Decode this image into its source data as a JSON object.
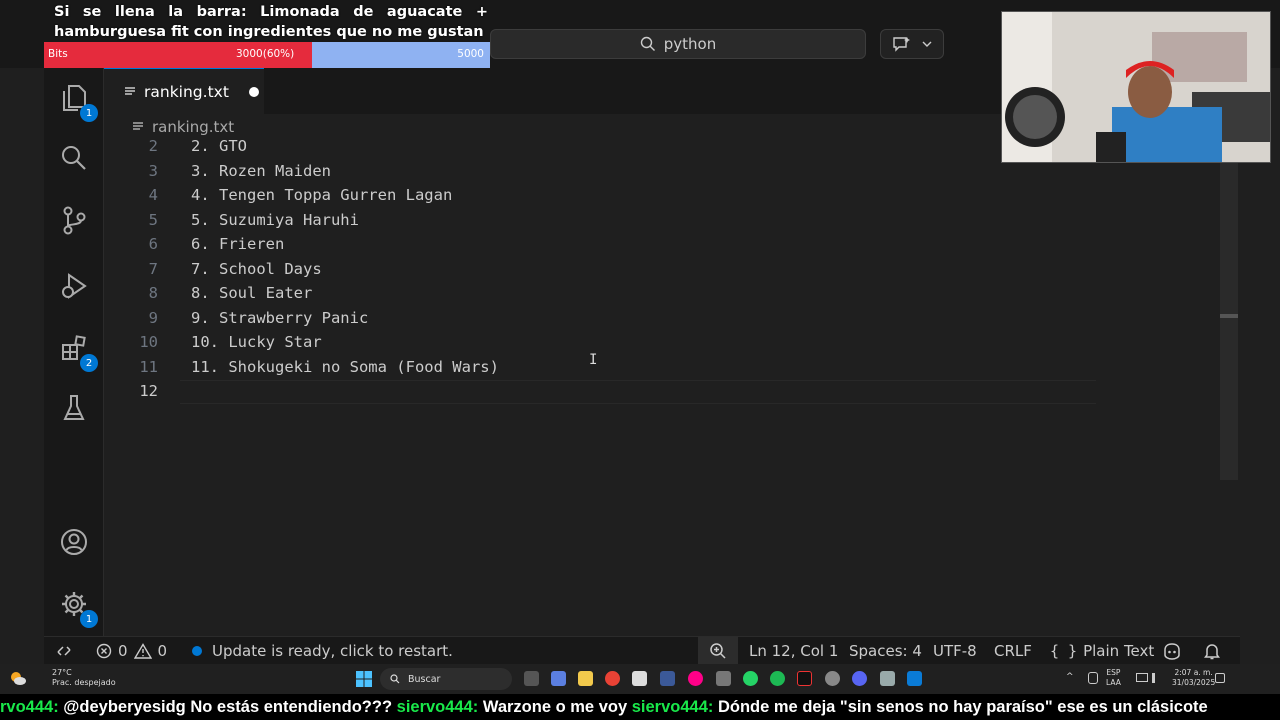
{
  "goal": {
    "text": "Si se llena la barra: Limonada de aguacate + hamburguesa fit con ingredientes que no me gustan",
    "bits_label": "Bits",
    "progress_label": "3000(60%)",
    "target_label": "5000",
    "progress_fraction": 0.6,
    "fill_color": "#e52b3d",
    "rest_color": "#8fb2f2"
  },
  "titlebar": {
    "search_text": "python"
  },
  "activity_bar": {
    "explorer_badge": "1",
    "extensions_badge": "2",
    "settings_badge": "1"
  },
  "tab": {
    "label": "ranking.txt"
  },
  "breadcrumb": {
    "file": "ranking.txt"
  },
  "editor": {
    "lines": [
      {
        "num": "2",
        "text": "2. GTO"
      },
      {
        "num": "3",
        "text": "3. Rozen Maiden"
      },
      {
        "num": "4",
        "text": "4. Tengen Toppa Gurren Lagan"
      },
      {
        "num": "5",
        "text": "5. Suzumiya Haruhi"
      },
      {
        "num": "6",
        "text": "6. Frieren"
      },
      {
        "num": "7",
        "text": "7. School Days"
      },
      {
        "num": "8",
        "text": "8. Soul Eater"
      },
      {
        "num": "9",
        "text": "9. Strawberry Panic"
      },
      {
        "num": "10",
        "text": "10. Lucky Star"
      },
      {
        "num": "11",
        "text": "11. Shokugeki no Soma (Food Wars)"
      },
      {
        "num": "12",
        "text": ""
      }
    ]
  },
  "statusbar": {
    "errors": "0",
    "warnings": "0",
    "update_message": "Update is ready, click to restart.",
    "cursor_position": "Ln 12, Col 1",
    "spaces": "Spaces: 4",
    "encoding": "UTF-8",
    "eol": "CRLF",
    "language": "Plain Text"
  },
  "taskbar": {
    "temperature": "27°C",
    "weather": "Prac. despejado",
    "search_placeholder": "Buscar",
    "lang_top": "ESP",
    "lang_bottom": "LAA",
    "time": "2:07 a. m.",
    "date": "31/03/2025"
  },
  "chat": [
    {
      "user": "rvo444:",
      "msg": "@deyberyesidg No estás entendiendo???"
    },
    {
      "user": "siervo444:",
      "msg": "Warzone o me voy"
    },
    {
      "user": "siervo444:",
      "msg": "Dónde me deja \"sin senos no hay paraíso\" ese es un clásicote"
    }
  ]
}
